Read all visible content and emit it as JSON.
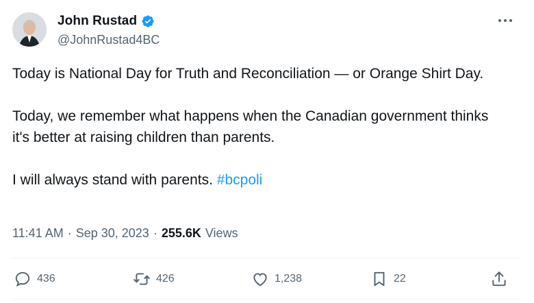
{
  "author": {
    "name": "John Rustad",
    "handle": "@JohnRustad4BC",
    "verified": true
  },
  "tweet": {
    "paragraph1": "Today is National Day for Truth and Reconciliation — or Orange Shirt Day.",
    "paragraph2": "Today, we remember what happens when the Canadian government thinks it's better at raising children than parents.",
    "paragraph3_text": "I will always stand with parents. ",
    "hashtag": "#bcpoli"
  },
  "meta": {
    "time": "11:41 AM",
    "separator": "·",
    "date": "Sep 30, 2023",
    "views_count": "255.6K",
    "views_label": "Views"
  },
  "actions": {
    "replies": "436",
    "reposts": "426",
    "likes": "1,238",
    "bookmarks": "22"
  },
  "colors": {
    "accent": "#1d9bf0",
    "text_primary": "#0f1419",
    "text_secondary": "#536471"
  },
  "icons": [
    "verified-badge-icon",
    "more-icon",
    "reply-icon",
    "repost-icon",
    "like-icon",
    "bookmark-icon",
    "share-icon"
  ]
}
